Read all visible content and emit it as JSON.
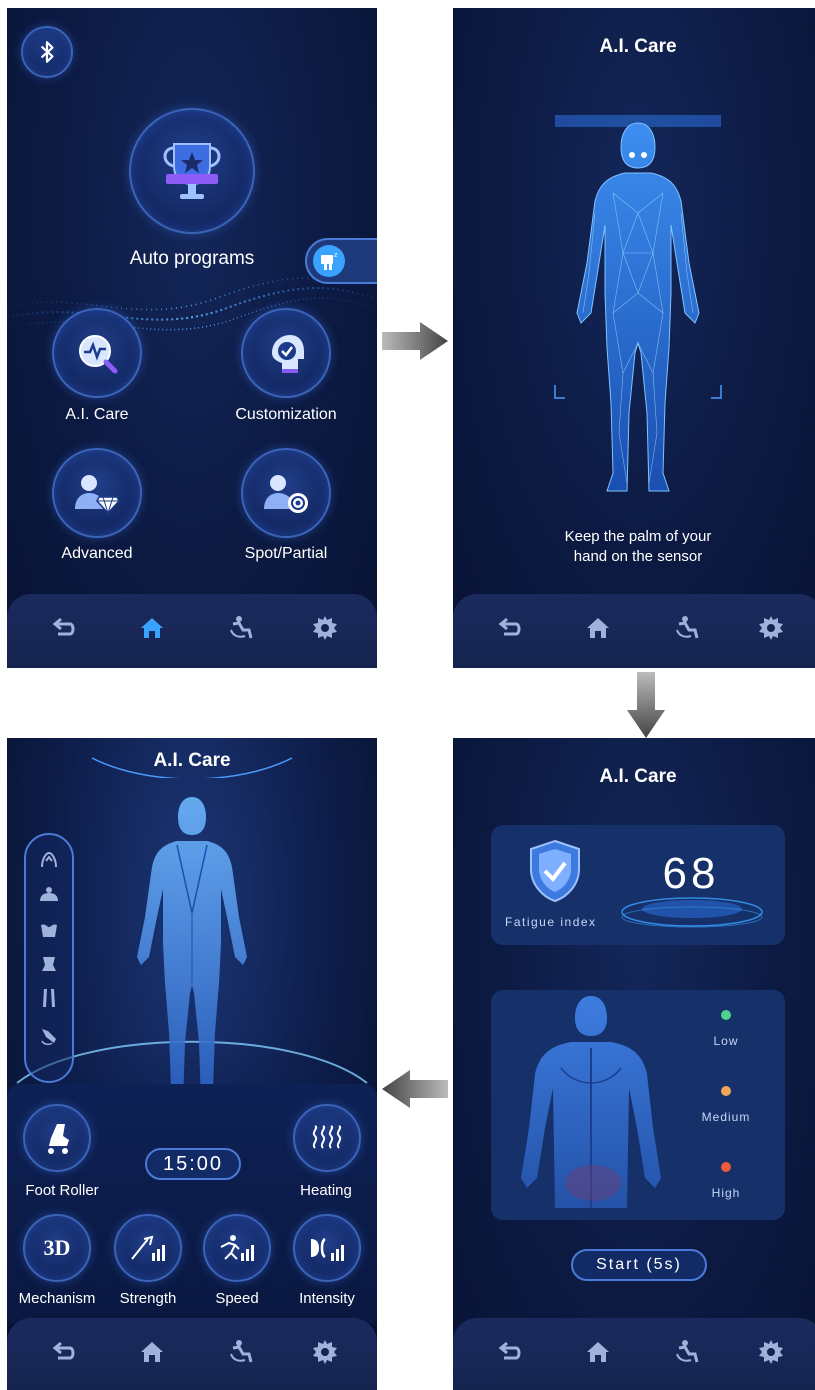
{
  "screen1": {
    "auto_programs_label": "Auto programs",
    "ai_care_label": "A.I. Care",
    "customization_label": "Customization",
    "advanced_label": "Advanced",
    "spot_partial_label": "Spot/Partial"
  },
  "screen2": {
    "title": "A.I. Care",
    "instruction_line1": "Keep the palm of your",
    "instruction_line2": "hand on the sensor"
  },
  "screen3": {
    "title": "A.I. Care",
    "timer": "15:00",
    "foot_roller_label": "Foot Roller",
    "heating_label": "Heating",
    "mechanism_label": "Mechanism",
    "mechanism_badge": "3D",
    "strength_label": "Strength",
    "speed_label": "Speed",
    "intensity_label": "Intensity"
  },
  "screen4": {
    "title": "A.I. Care",
    "fatigue_value": "68",
    "fatigue_label": "Fatigue index",
    "legend": [
      {
        "label": "Low",
        "color": "#4fd18b"
      },
      {
        "label": "Medium",
        "color": "#f2a65a"
      },
      {
        "label": "High",
        "color": "#ef5a3c"
      }
    ],
    "start_button": "Start (5s)"
  },
  "nav_items": [
    "back-icon",
    "home-icon",
    "massage-chair-icon",
    "settings-icon"
  ],
  "colors": {
    "screen_bg": "#0c1a42",
    "accent": "#3aa3ff",
    "nav_bg": "#1a2a5e",
    "arrow": "#555555"
  }
}
